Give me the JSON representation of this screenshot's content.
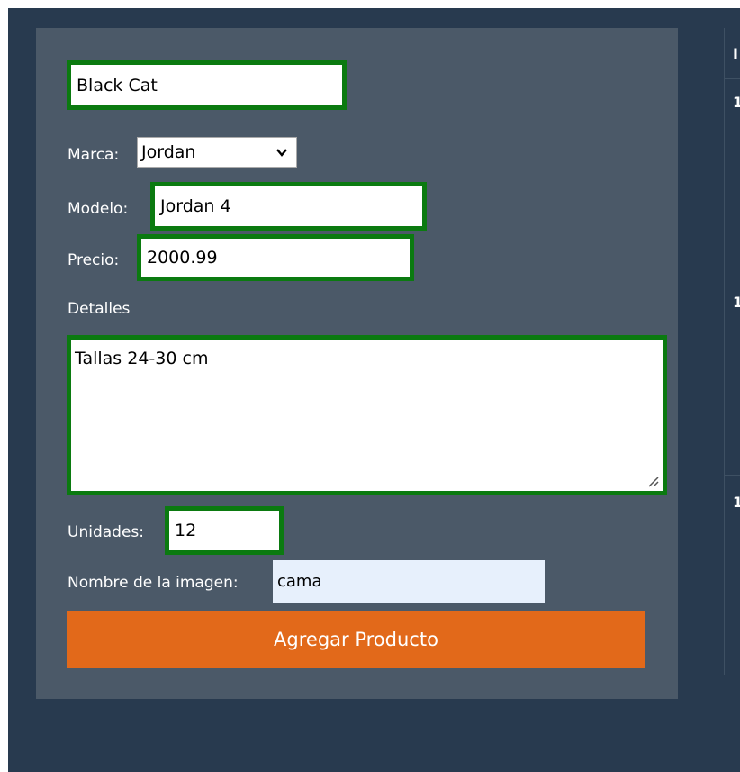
{
  "form": {
    "name_value": "Black Cat",
    "brand_label": "Marca:",
    "brand_selected": "Jordan",
    "model_label": "Modelo:",
    "model_value": "Jordan 4",
    "price_label": "Precio:",
    "price_value": "2000.99",
    "details_label": "Detalles",
    "details_value": "Tallas 24-30 cm",
    "units_label": "Unidades:",
    "units_value": "12",
    "image_label": "Nombre de la imagen:",
    "image_value": "cama",
    "submit_label": "Agregar Producto"
  },
  "table": {
    "header_fragment": "I",
    "row_id_fragments": [
      "1",
      "1",
      "1"
    ]
  },
  "colors": {
    "page_background": "#283a4f",
    "panel_background": "#4b5968",
    "valid_border": "#0b7a10",
    "button": "#e2691a"
  }
}
